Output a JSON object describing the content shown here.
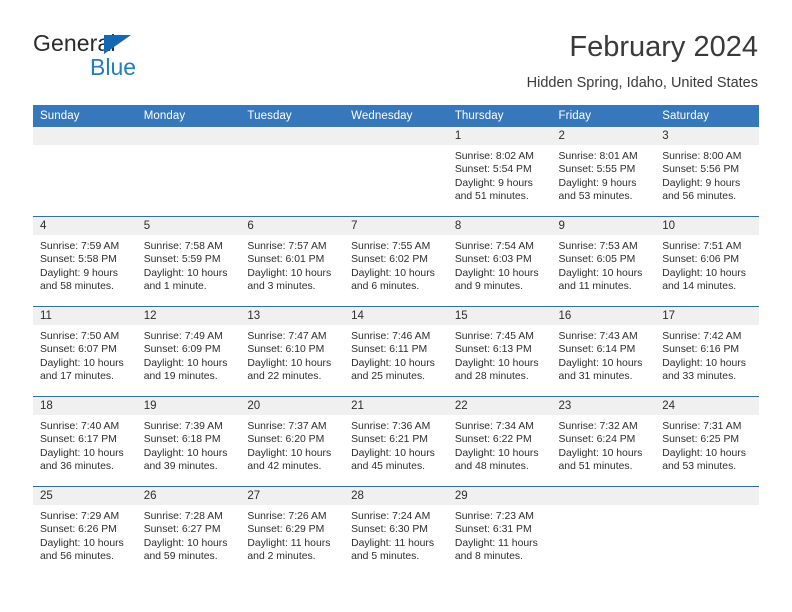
{
  "brand": {
    "name_top": "General",
    "name_bottom": "Blue",
    "flag_icon": "triangle-flag-icon"
  },
  "header": {
    "month_title": "February 2024",
    "location": "Hidden Spring, Idaho, United States"
  },
  "colors": {
    "header_blue": "#3778bc",
    "row_divider_blue": "#2f6fb2",
    "daynum_band": "#f0f0f0",
    "brand_blue": "#1f7ec4",
    "text": "#2d2d2d"
  },
  "calendar": {
    "weekday_headers": [
      "Sunday",
      "Monday",
      "Tuesday",
      "Wednesday",
      "Thursday",
      "Friday",
      "Saturday"
    ],
    "weeks": [
      [
        {
          "day": "",
          "empty": true
        },
        {
          "day": "",
          "empty": true
        },
        {
          "day": "",
          "empty": true
        },
        {
          "day": "",
          "empty": true
        },
        {
          "day": "1",
          "sunrise": "Sunrise: 8:02 AM",
          "sunset": "Sunset: 5:54 PM",
          "daylight_line1": "Daylight: 9 hours",
          "daylight_line2": "and 51 minutes."
        },
        {
          "day": "2",
          "sunrise": "Sunrise: 8:01 AM",
          "sunset": "Sunset: 5:55 PM",
          "daylight_line1": "Daylight: 9 hours",
          "daylight_line2": "and 53 minutes."
        },
        {
          "day": "3",
          "sunrise": "Sunrise: 8:00 AM",
          "sunset": "Sunset: 5:56 PM",
          "daylight_line1": "Daylight: 9 hours",
          "daylight_line2": "and 56 minutes."
        }
      ],
      [
        {
          "day": "4",
          "sunrise": "Sunrise: 7:59 AM",
          "sunset": "Sunset: 5:58 PM",
          "daylight_line1": "Daylight: 9 hours",
          "daylight_line2": "and 58 minutes."
        },
        {
          "day": "5",
          "sunrise": "Sunrise: 7:58 AM",
          "sunset": "Sunset: 5:59 PM",
          "daylight_line1": "Daylight: 10 hours",
          "daylight_line2": "and 1 minute."
        },
        {
          "day": "6",
          "sunrise": "Sunrise: 7:57 AM",
          "sunset": "Sunset: 6:01 PM",
          "daylight_line1": "Daylight: 10 hours",
          "daylight_line2": "and 3 minutes."
        },
        {
          "day": "7",
          "sunrise": "Sunrise: 7:55 AM",
          "sunset": "Sunset: 6:02 PM",
          "daylight_line1": "Daylight: 10 hours",
          "daylight_line2": "and 6 minutes."
        },
        {
          "day": "8",
          "sunrise": "Sunrise: 7:54 AM",
          "sunset": "Sunset: 6:03 PM",
          "daylight_line1": "Daylight: 10 hours",
          "daylight_line2": "and 9 minutes."
        },
        {
          "day": "9",
          "sunrise": "Sunrise: 7:53 AM",
          "sunset": "Sunset: 6:05 PM",
          "daylight_line1": "Daylight: 10 hours",
          "daylight_line2": "and 11 minutes."
        },
        {
          "day": "10",
          "sunrise": "Sunrise: 7:51 AM",
          "sunset": "Sunset: 6:06 PM",
          "daylight_line1": "Daylight: 10 hours",
          "daylight_line2": "and 14 minutes."
        }
      ],
      [
        {
          "day": "11",
          "sunrise": "Sunrise: 7:50 AM",
          "sunset": "Sunset: 6:07 PM",
          "daylight_line1": "Daylight: 10 hours",
          "daylight_line2": "and 17 minutes."
        },
        {
          "day": "12",
          "sunrise": "Sunrise: 7:49 AM",
          "sunset": "Sunset: 6:09 PM",
          "daylight_line1": "Daylight: 10 hours",
          "daylight_line2": "and 19 minutes."
        },
        {
          "day": "13",
          "sunrise": "Sunrise: 7:47 AM",
          "sunset": "Sunset: 6:10 PM",
          "daylight_line1": "Daylight: 10 hours",
          "daylight_line2": "and 22 minutes."
        },
        {
          "day": "14",
          "sunrise": "Sunrise: 7:46 AM",
          "sunset": "Sunset: 6:11 PM",
          "daylight_line1": "Daylight: 10 hours",
          "daylight_line2": "and 25 minutes."
        },
        {
          "day": "15",
          "sunrise": "Sunrise: 7:45 AM",
          "sunset": "Sunset: 6:13 PM",
          "daylight_line1": "Daylight: 10 hours",
          "daylight_line2": "and 28 minutes."
        },
        {
          "day": "16",
          "sunrise": "Sunrise: 7:43 AM",
          "sunset": "Sunset: 6:14 PM",
          "daylight_line1": "Daylight: 10 hours",
          "daylight_line2": "and 31 minutes."
        },
        {
          "day": "17",
          "sunrise": "Sunrise: 7:42 AM",
          "sunset": "Sunset: 6:16 PM",
          "daylight_line1": "Daylight: 10 hours",
          "daylight_line2": "and 33 minutes."
        }
      ],
      [
        {
          "day": "18",
          "sunrise": "Sunrise: 7:40 AM",
          "sunset": "Sunset: 6:17 PM",
          "daylight_line1": "Daylight: 10 hours",
          "daylight_line2": "and 36 minutes."
        },
        {
          "day": "19",
          "sunrise": "Sunrise: 7:39 AM",
          "sunset": "Sunset: 6:18 PM",
          "daylight_line1": "Daylight: 10 hours",
          "daylight_line2": "and 39 minutes."
        },
        {
          "day": "20",
          "sunrise": "Sunrise: 7:37 AM",
          "sunset": "Sunset: 6:20 PM",
          "daylight_line1": "Daylight: 10 hours",
          "daylight_line2": "and 42 minutes."
        },
        {
          "day": "21",
          "sunrise": "Sunrise: 7:36 AM",
          "sunset": "Sunset: 6:21 PM",
          "daylight_line1": "Daylight: 10 hours",
          "daylight_line2": "and 45 minutes."
        },
        {
          "day": "22",
          "sunrise": "Sunrise: 7:34 AM",
          "sunset": "Sunset: 6:22 PM",
          "daylight_line1": "Daylight: 10 hours",
          "daylight_line2": "and 48 minutes."
        },
        {
          "day": "23",
          "sunrise": "Sunrise: 7:32 AM",
          "sunset": "Sunset: 6:24 PM",
          "daylight_line1": "Daylight: 10 hours",
          "daylight_line2": "and 51 minutes."
        },
        {
          "day": "24",
          "sunrise": "Sunrise: 7:31 AM",
          "sunset": "Sunset: 6:25 PM",
          "daylight_line1": "Daylight: 10 hours",
          "daylight_line2": "and 53 minutes."
        }
      ],
      [
        {
          "day": "25",
          "sunrise": "Sunrise: 7:29 AM",
          "sunset": "Sunset: 6:26 PM",
          "daylight_line1": "Daylight: 10 hours",
          "daylight_line2": "and 56 minutes."
        },
        {
          "day": "26",
          "sunrise": "Sunrise: 7:28 AM",
          "sunset": "Sunset: 6:27 PM",
          "daylight_line1": "Daylight: 10 hours",
          "daylight_line2": "and 59 minutes."
        },
        {
          "day": "27",
          "sunrise": "Sunrise: 7:26 AM",
          "sunset": "Sunset: 6:29 PM",
          "daylight_line1": "Daylight: 11 hours",
          "daylight_line2": "and 2 minutes."
        },
        {
          "day": "28",
          "sunrise": "Sunrise: 7:24 AM",
          "sunset": "Sunset: 6:30 PM",
          "daylight_line1": "Daylight: 11 hours",
          "daylight_line2": "and 5 minutes."
        },
        {
          "day": "29",
          "sunrise": "Sunrise: 7:23 AM",
          "sunset": "Sunset: 6:31 PM",
          "daylight_line1": "Daylight: 11 hours",
          "daylight_line2": "and 8 minutes."
        },
        {
          "day": "",
          "empty": true
        },
        {
          "day": "",
          "empty": true
        }
      ]
    ]
  }
}
